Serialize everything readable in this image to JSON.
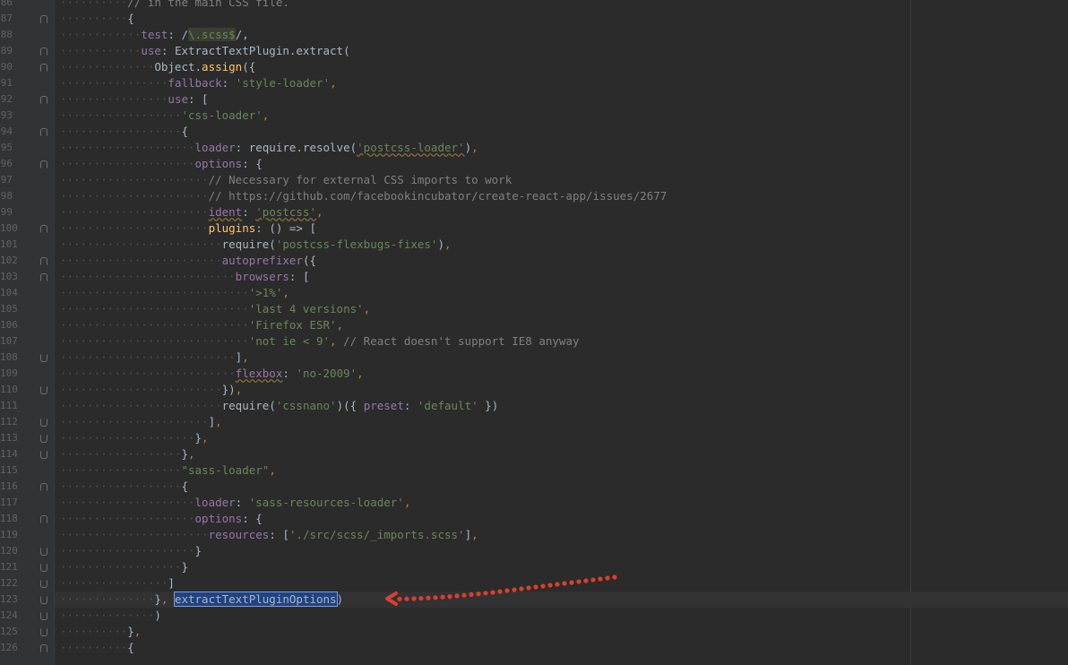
{
  "editor": {
    "lines": [
      {
        "n": "86",
        "fold": "",
        "segs": [
          [
            "ws",
            "··········"
          ],
          [
            "com",
            "// in the main CSS file."
          ]
        ]
      },
      {
        "n": "87",
        "fold": "start",
        "segs": [
          [
            "ws",
            "··········"
          ],
          [
            "p",
            "{"
          ]
        ]
      },
      {
        "n": "88",
        "fold": "",
        "segs": [
          [
            "ws",
            "············"
          ],
          [
            "prop",
            "test"
          ],
          [
            "p",
            ": /"
          ],
          [
            "rx",
            "\\.scss$"
          ],
          [
            "p",
            "/,"
          ]
        ]
      },
      {
        "n": "89",
        "fold": "start",
        "segs": [
          [
            "ws",
            "············"
          ],
          [
            "prop",
            "use"
          ],
          [
            "p",
            ": ExtractTextPlugin."
          ],
          [
            "p",
            "extract("
          ]
        ]
      },
      {
        "n": "90",
        "fold": "start",
        "segs": [
          [
            "ws",
            "··············"
          ],
          [
            "p",
            "Object."
          ],
          [
            "fn",
            "assign"
          ],
          [
            "p",
            "({"
          ]
        ]
      },
      {
        "n": "91",
        "fold": "",
        "segs": [
          [
            "ws",
            "················"
          ],
          [
            "prop",
            "fallback"
          ],
          [
            "p",
            ": "
          ],
          [
            "str",
            "'style-loader'"
          ],
          [
            "kw",
            ","
          ]
        ]
      },
      {
        "n": "92",
        "fold": "start",
        "segs": [
          [
            "ws",
            "················"
          ],
          [
            "prop",
            "use"
          ],
          [
            "p",
            ": ["
          ]
        ]
      },
      {
        "n": "93",
        "fold": "",
        "segs": [
          [
            "ws",
            "··················"
          ],
          [
            "str",
            "'css-loader'"
          ],
          [
            "kw",
            ","
          ]
        ]
      },
      {
        "n": "94",
        "fold": "start",
        "segs": [
          [
            "ws",
            "··················"
          ],
          [
            "p",
            "{"
          ]
        ]
      },
      {
        "n": "95",
        "fold": "",
        "segs": [
          [
            "ws",
            "····················"
          ],
          [
            "prop",
            "loader"
          ],
          [
            "p",
            ": require.resolve("
          ],
          [
            "str",
            "'postcss-loader'"
          ],
          [
            "p",
            ")"
          ],
          [
            "kw",
            ","
          ]
        ]
      },
      {
        "n": "96",
        "fold": "start",
        "segs": [
          [
            "ws",
            "····················"
          ],
          [
            "prop",
            "options"
          ],
          [
            "p",
            ": {"
          ]
        ]
      },
      {
        "n": "97",
        "fold": "",
        "segs": [
          [
            "ws",
            "······················"
          ],
          [
            "com",
            "// Necessary for external CSS imports to work"
          ]
        ]
      },
      {
        "n": "98",
        "fold": "",
        "segs": [
          [
            "ws",
            "······················"
          ],
          [
            "com",
            "// https://github.com/facebookincubator/create-react-app/issues/2677"
          ]
        ]
      },
      {
        "n": "99",
        "fold": "",
        "segs": [
          [
            "ws",
            "······················"
          ],
          [
            "prop",
            "ident"
          ],
          [
            "p",
            ": "
          ],
          [
            "str",
            "'postcss'"
          ],
          [
            "kw",
            ","
          ]
        ]
      },
      {
        "n": "100",
        "fold": "start",
        "segs": [
          [
            "ws",
            "······················"
          ],
          [
            "fn",
            "plugins"
          ],
          [
            "p",
            ": () => ["
          ]
        ]
      },
      {
        "n": "101",
        "fold": "",
        "segs": [
          [
            "ws",
            "························"
          ],
          [
            "p",
            "require("
          ],
          [
            "str",
            "'postcss-flexbugs-fixes'"
          ],
          [
            "p",
            ")"
          ],
          [
            "kw",
            ","
          ]
        ]
      },
      {
        "n": "102",
        "fold": "start",
        "segs": [
          [
            "ws",
            "························"
          ],
          [
            "prop",
            "autoprefixer"
          ],
          [
            "p",
            "({"
          ]
        ]
      },
      {
        "n": "103",
        "fold": "start",
        "segs": [
          [
            "ws",
            "··························"
          ],
          [
            "prop",
            "browsers"
          ],
          [
            "p",
            ": ["
          ]
        ]
      },
      {
        "n": "104",
        "fold": "",
        "segs": [
          [
            "ws",
            "····························"
          ],
          [
            "str",
            "'>1%'"
          ],
          [
            "kw",
            ","
          ]
        ]
      },
      {
        "n": "105",
        "fold": "",
        "segs": [
          [
            "ws",
            "····························"
          ],
          [
            "str",
            "'last 4 versions'"
          ],
          [
            "kw",
            ","
          ]
        ]
      },
      {
        "n": "106",
        "fold": "",
        "segs": [
          [
            "ws",
            "····························"
          ],
          [
            "str",
            "'Firefox ESR'"
          ],
          [
            "kw",
            ","
          ]
        ]
      },
      {
        "n": "107",
        "fold": "",
        "segs": [
          [
            "ws",
            "····························"
          ],
          [
            "str",
            "'not ie < 9'"
          ],
          [
            "kw",
            ", "
          ],
          [
            "com",
            "// React doesn't support IE8 anyway"
          ]
        ]
      },
      {
        "n": "108",
        "fold": "end",
        "segs": [
          [
            "ws",
            "··························"
          ],
          [
            "p",
            "]"
          ],
          [
            "kw",
            ","
          ]
        ]
      },
      {
        "n": "109",
        "fold": "",
        "segs": [
          [
            "ws",
            "··························"
          ],
          [
            "prop",
            "flexbox"
          ],
          [
            "p",
            ": "
          ],
          [
            "str",
            "'no-2009'"
          ],
          [
            "kw",
            ","
          ]
        ]
      },
      {
        "n": "110",
        "fold": "end",
        "segs": [
          [
            "ws",
            "························"
          ],
          [
            "p",
            "})"
          ],
          [
            "kw",
            ","
          ]
        ]
      },
      {
        "n": "111",
        "fold": "",
        "segs": [
          [
            "ws",
            "························"
          ],
          [
            "p",
            "require("
          ],
          [
            "str",
            "'cssnano'"
          ],
          [
            "p",
            ")({ "
          ],
          [
            "prop",
            "preset"
          ],
          [
            "p",
            ": "
          ],
          [
            "str",
            "'default'"
          ],
          [
            "p",
            " })"
          ]
        ]
      },
      {
        "n": "112",
        "fold": "end",
        "segs": [
          [
            "ws",
            "······················"
          ],
          [
            "p",
            "]"
          ],
          [
            "kw",
            ","
          ]
        ]
      },
      {
        "n": "113",
        "fold": "end",
        "segs": [
          [
            "ws",
            "····················"
          ],
          [
            "p",
            "}"
          ],
          [
            "kw",
            ","
          ]
        ]
      },
      {
        "n": "114",
        "fold": "end",
        "segs": [
          [
            "ws",
            "··················"
          ],
          [
            "p",
            "}"
          ],
          [
            "kw",
            ","
          ]
        ]
      },
      {
        "n": "115",
        "fold": "",
        "segs": [
          [
            "ws",
            "··················"
          ],
          [
            "str",
            "\"sass-loader\""
          ],
          [
            "kw",
            ","
          ]
        ]
      },
      {
        "n": "116",
        "fold": "start",
        "segs": [
          [
            "ws",
            "··················"
          ],
          [
            "p",
            "{"
          ]
        ]
      },
      {
        "n": "117",
        "fold": "",
        "segs": [
          [
            "ws",
            "····················"
          ],
          [
            "prop",
            "loader"
          ],
          [
            "p",
            ": "
          ],
          [
            "str",
            "'sass-resources-loader'"
          ],
          [
            "kw",
            ","
          ]
        ]
      },
      {
        "n": "118",
        "fold": "start",
        "segs": [
          [
            "ws",
            "····················"
          ],
          [
            "prop",
            "options"
          ],
          [
            "p",
            ": {"
          ]
        ]
      },
      {
        "n": "119",
        "fold": "",
        "segs": [
          [
            "ws",
            "······················"
          ],
          [
            "prop",
            "resources"
          ],
          [
            "p",
            ": ["
          ],
          [
            "str",
            "'./src/scss/_imports.scss'"
          ],
          [
            "p",
            "]"
          ],
          [
            "kw",
            ","
          ]
        ]
      },
      {
        "n": "120",
        "fold": "end",
        "segs": [
          [
            "ws",
            "····················"
          ],
          [
            "p",
            "}"
          ]
        ]
      },
      {
        "n": "121",
        "fold": "end",
        "segs": [
          [
            "ws",
            "··················"
          ],
          [
            "p",
            "}"
          ]
        ]
      },
      {
        "n": "122",
        "fold": "end",
        "segs": [
          [
            "ws",
            "················"
          ],
          [
            "p",
            "]"
          ]
        ]
      },
      {
        "n": "123",
        "fold": "end",
        "segs": [
          [
            "ws",
            "··············"
          ],
          [
            "p",
            "}"
          ],
          [
            "kw",
            ", "
          ],
          [
            "sel",
            "extractTextPluginOptions"
          ],
          [
            "p",
            ")"
          ]
        ]
      },
      {
        "n": "124",
        "fold": "end",
        "segs": [
          [
            "ws",
            "··············"
          ],
          [
            "p",
            ")"
          ]
        ]
      },
      {
        "n": "125",
        "fold": "end",
        "segs": [
          [
            "ws",
            "··········"
          ],
          [
            "p",
            "}"
          ],
          [
            "kw",
            ","
          ]
        ]
      },
      {
        "n": "126",
        "fold": "start",
        "segs": [
          [
            "ws",
            "··········"
          ],
          [
            "p",
            "{"
          ]
        ]
      }
    ],
    "current_line": "123"
  },
  "colors": {
    "background": "#2b2b2b",
    "gutter": "#313335",
    "arrow": "#d9402f"
  }
}
